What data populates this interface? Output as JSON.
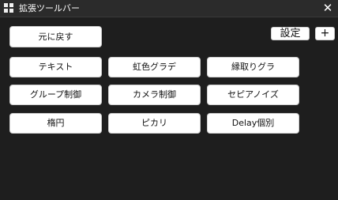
{
  "window": {
    "title": "拡張ツールバー",
    "close_glyph": "✕",
    "app_icon": "grid-icon"
  },
  "toolbar": {
    "reset_label": "元に戻す",
    "settings_label": "設定",
    "add_label": "+"
  },
  "grid": {
    "rows": [
      [
        "テキスト",
        "虹色グラデ",
        "縁取りグラ"
      ],
      [
        "グループ制御",
        "カメラ制御",
        "セピアノイズ"
      ],
      [
        "楕円",
        "ピカリ",
        "Delay個別"
      ]
    ]
  }
}
